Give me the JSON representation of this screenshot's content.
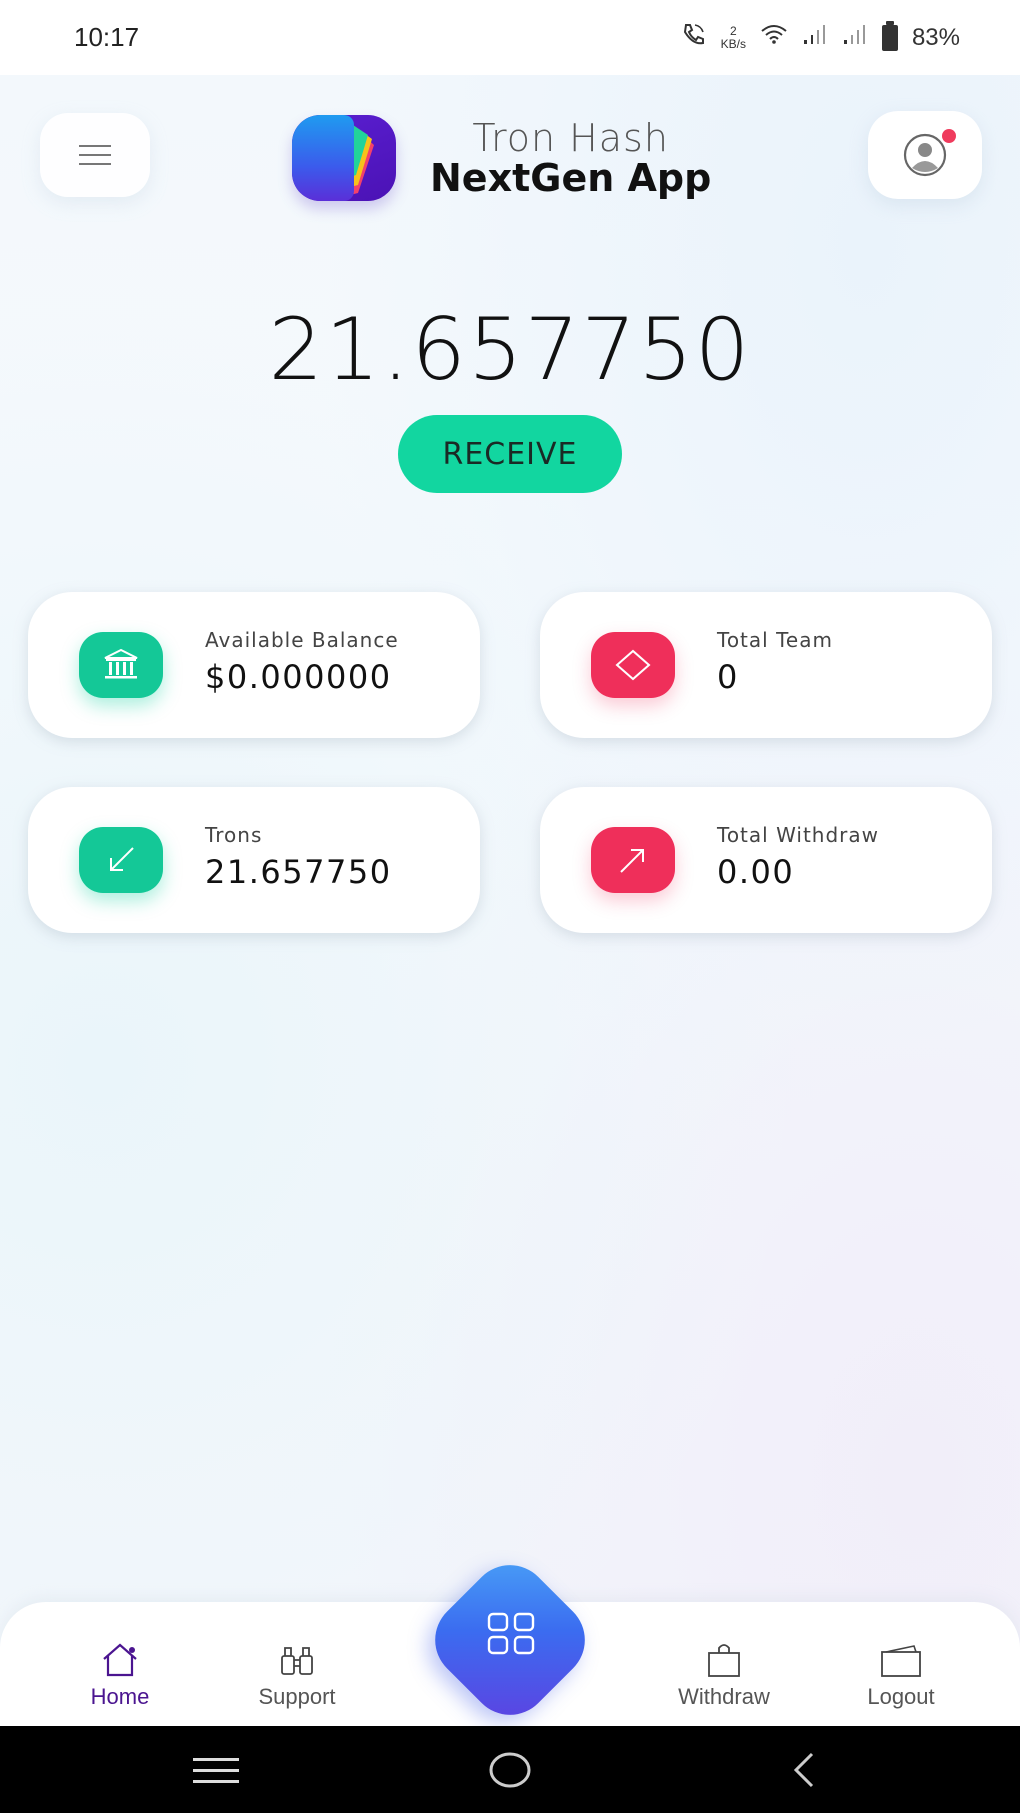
{
  "status_bar": {
    "time": "10:17",
    "net_speed_value": "2",
    "net_speed_unit": "KB/s",
    "battery_percent": "83%",
    "icons": [
      "wifi-call-icon",
      "wifi-icon",
      "signal-icon",
      "signal-icon",
      "battery-icon"
    ]
  },
  "header": {
    "menu_icon": "hamburger-icon",
    "brand_line1": "Tron Hash",
    "brand_line2": "NextGen App",
    "profile_icon": "user-circle-icon",
    "notification_dot_color": "#ef3b5d"
  },
  "hero": {
    "balance": "21.657750",
    "receive_label": "RECEIVE",
    "accent": "#12d6a0"
  },
  "cards": [
    {
      "label": "Available Balance",
      "value": "$0.000000",
      "icon": "bank-icon",
      "color": "#14c897"
    },
    {
      "label": "Total Team",
      "value": "0",
      "icon": "diamond-icon",
      "color": "#ef2f5a"
    },
    {
      "label": "Trons",
      "value": "21.657750",
      "icon": "arrow-down-left-icon",
      "color": "#14c897"
    },
    {
      "label": "Total Withdraw",
      "value": "0.00",
      "icon": "arrow-up-right-icon",
      "color": "#ef2f5a"
    }
  ],
  "bottom_nav": {
    "items": [
      {
        "label": "Home",
        "icon": "home-icon",
        "active": true
      },
      {
        "label": "Support",
        "icon": "binoculars-icon",
        "active": false
      },
      {
        "label": "Withdraw",
        "icon": "shopping-bag-icon",
        "active": false
      },
      {
        "label": "Logout",
        "icon": "wallet-icon",
        "active": false
      }
    ],
    "center_button_icon": "grid-icon",
    "active_color": "#4b1590"
  },
  "system_nav": {
    "buttons": [
      "recents-icon",
      "home-circle-icon",
      "back-icon"
    ]
  }
}
